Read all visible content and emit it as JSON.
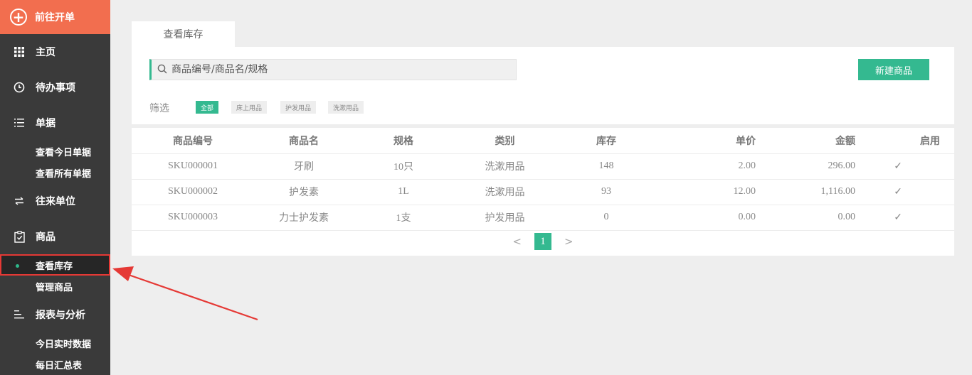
{
  "sidebar": {
    "go_order": "前往开单",
    "items": {
      "home": "主页",
      "todo": "待办事项",
      "docs": "单据",
      "docs_today": "查看今日单据",
      "docs_all": "查看所有单据",
      "partners": "往来单位",
      "goods": "商品",
      "goods_stock": "查看库存",
      "goods_manage": "管理商品",
      "reports": "报表与分析",
      "reports_today": "今日实时数据",
      "reports_daily": "每日汇总表"
    }
  },
  "main": {
    "tab": "查看库存",
    "search_placeholder": "商品编号/商品名/规格",
    "new_button": "新建商品",
    "filter_label": "筛选",
    "filters": [
      "全部",
      "床上用品",
      "护发用品",
      "洗漱用品"
    ]
  },
  "table": {
    "headers": [
      "商品编号",
      "商品名",
      "规格",
      "类别",
      "库存",
      "单价",
      "金额",
      "启用"
    ],
    "rows": [
      {
        "code": "SKU000001",
        "name": "牙刷",
        "spec": "10只",
        "category": "洗漱用品",
        "stock": "148",
        "price": "2.00",
        "amount": "296.00",
        "enabled": "✓"
      },
      {
        "code": "SKU000002",
        "name": "护发素",
        "spec": "1L",
        "category": "洗漱用品",
        "stock": "93",
        "price": "12.00",
        "amount": "1,116.00",
        "enabled": "✓"
      },
      {
        "code": "SKU000003",
        "name": "力士护发素",
        "spec": "1支",
        "category": "护发用品",
        "stock": "0",
        "price": "0.00",
        "amount": "0.00",
        "enabled": "✓"
      }
    ]
  },
  "pager": {
    "prev": "<",
    "page": "1",
    "next": ">"
  },
  "colors": {
    "accent": "#34b990",
    "brand": "#f26e4f",
    "sidebar": "#3a3a3a",
    "highlight": "#e53935"
  }
}
